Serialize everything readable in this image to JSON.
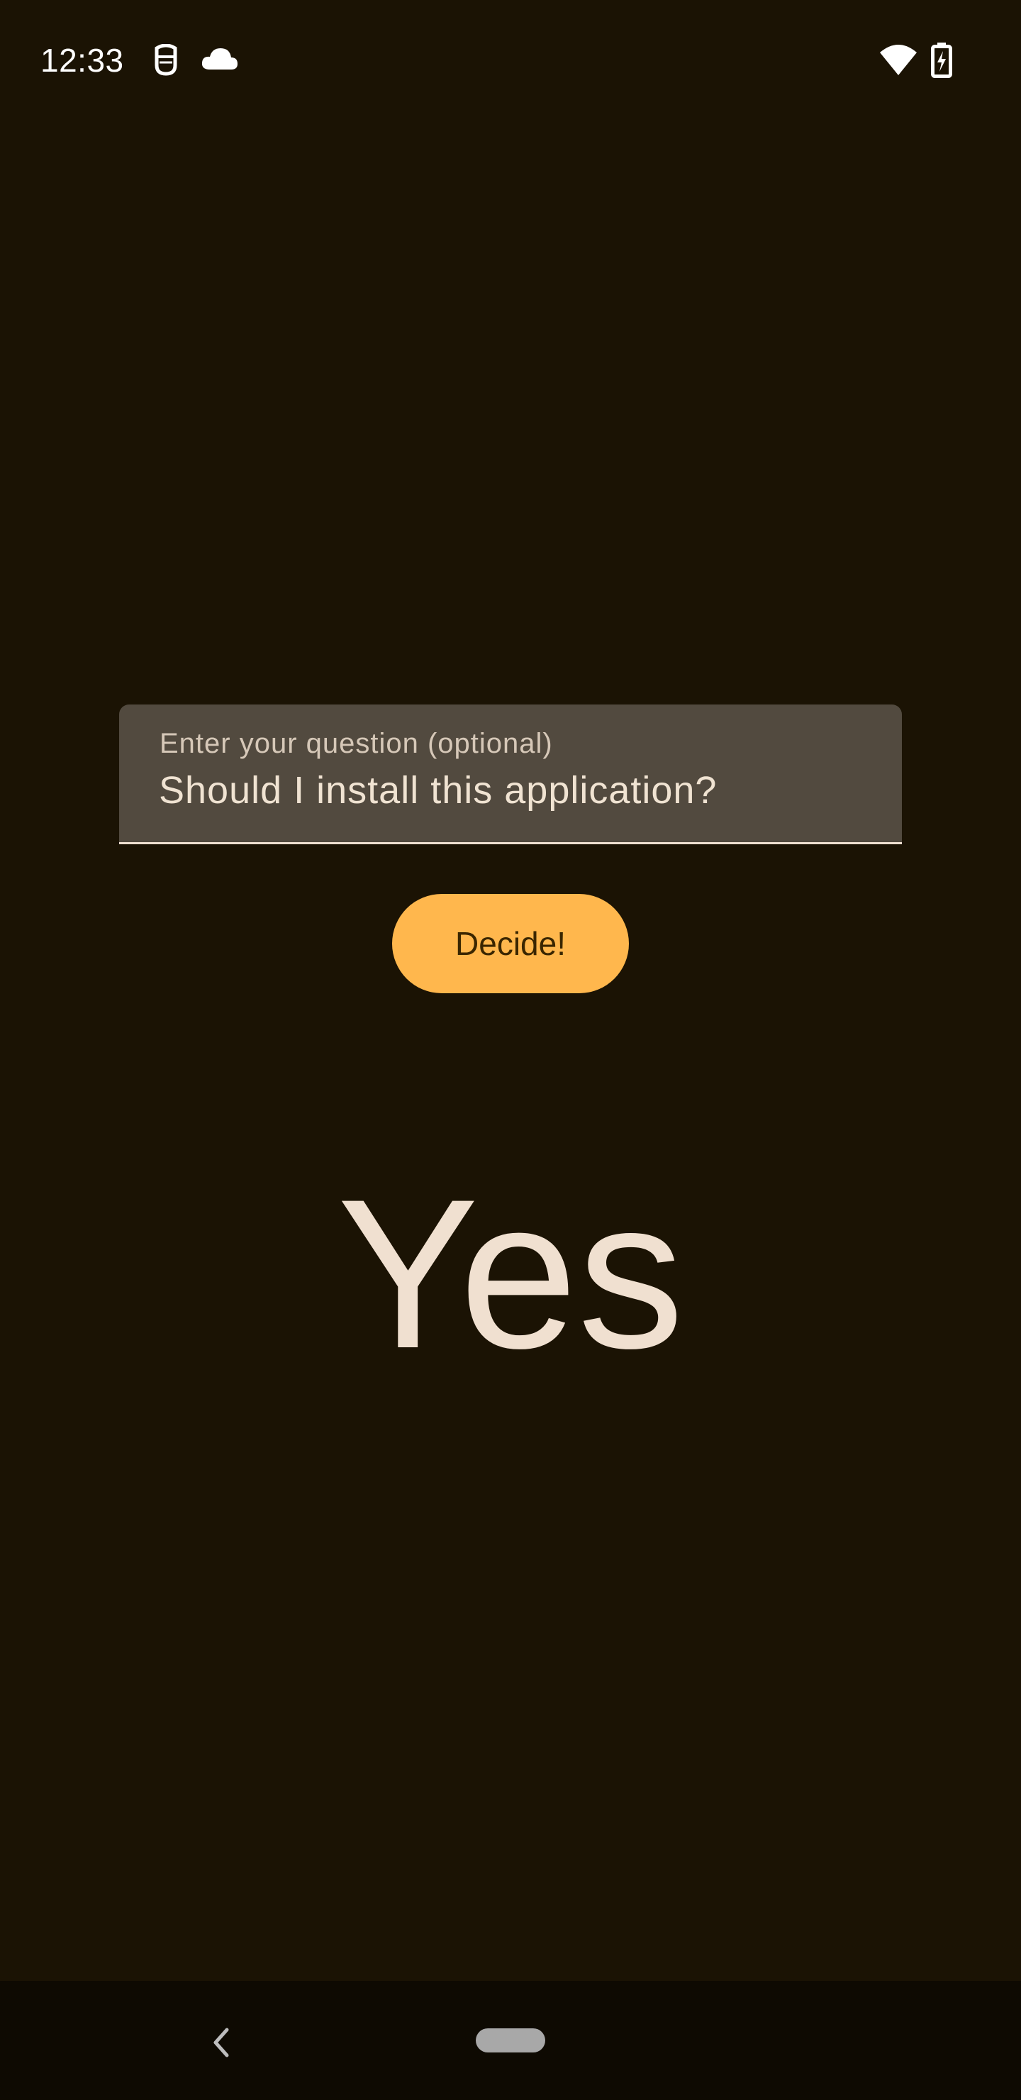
{
  "status_bar": {
    "time": "12:33",
    "icons": [
      "face-mask-icon",
      "cloud-icon",
      "wifi-icon",
      "battery-charging-icon"
    ]
  },
  "question_field": {
    "label": "Enter your question (optional)",
    "value": "Should I install this application?"
  },
  "decide_button": {
    "label": "Decide!"
  },
  "answer": {
    "text": "Yes"
  },
  "navigation": {
    "icons": [
      "back-icon",
      "home-pill-icon"
    ]
  },
  "colors": {
    "background": "#1b1304",
    "field_background": "#524a3f",
    "accent": "#ffb74d",
    "answer_text": "#f0e0d0",
    "nav_background": "#0e0a02"
  }
}
